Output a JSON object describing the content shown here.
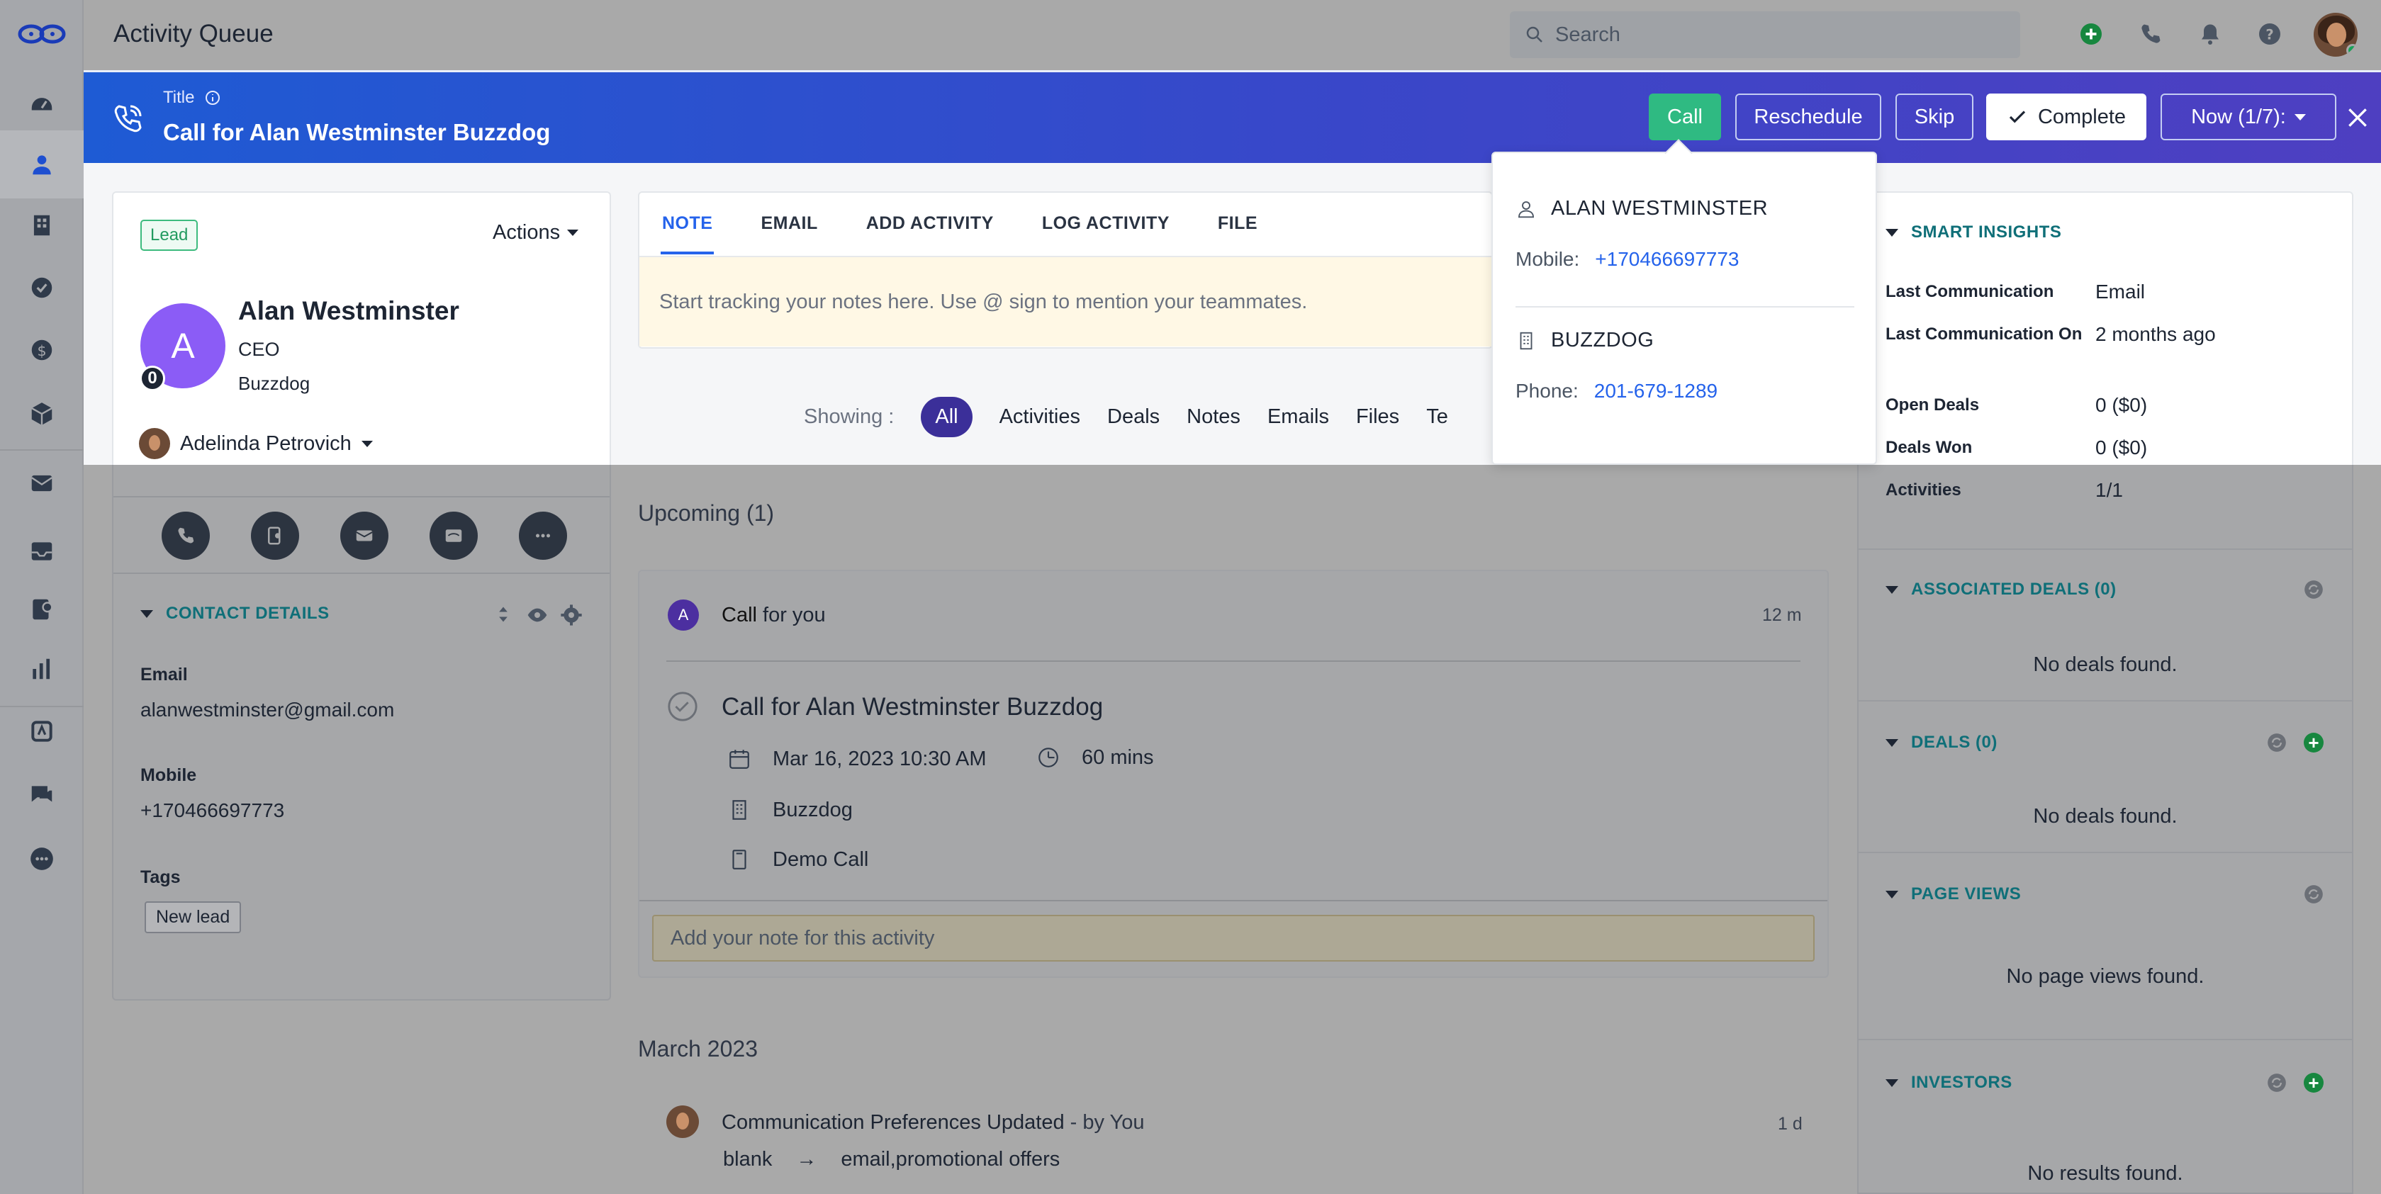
{
  "app": {
    "page_title": "Activity Queue"
  },
  "search": {
    "placeholder": "Search"
  },
  "banner": {
    "label": "Title",
    "title": "Call for Alan Westminster Buzzdog",
    "buttons": {
      "call": "Call",
      "reschedule": "Reschedule",
      "skip": "Skip",
      "complete": "Complete",
      "now": "Now (1/7):"
    }
  },
  "contact": {
    "badge": "Lead",
    "actions_label": "Actions",
    "initial": "A",
    "count_badge": "0",
    "name": "Alan Westminster",
    "title": "CEO",
    "company": "Buzzdog",
    "owner": "Adelinda Petrovich",
    "details_header": "CONTACT DETAILS",
    "fields": {
      "email_label": "Email",
      "email_value": "alanwestminster@gmail.com",
      "mobile_label": "Mobile",
      "mobile_value": "+170466697773",
      "tags_label": "Tags"
    },
    "tags": [
      "New lead"
    ]
  },
  "tabs": [
    "NOTE",
    "EMAIL",
    "ADD ACTIVITY",
    "LOG ACTIVITY",
    "FILE"
  ],
  "note": {
    "placeholder": "Start tracking your notes here. Use @ sign to mention your teammates."
  },
  "showing": {
    "label": "Showing :",
    "filters": [
      "All",
      "Activities",
      "Deals",
      "Notes",
      "Emails",
      "Files",
      "Te"
    ],
    "active": "All"
  },
  "popover": {
    "person_name": "ALAN WESTMINSTER",
    "mobile_label": "Mobile:",
    "mobile_value": "+170466697773",
    "company_name": "BUZZDOG",
    "phone_label": "Phone:",
    "phone_value": "201-679-1289"
  },
  "insights": {
    "header": "SMART INSIGHTS",
    "rows": [
      {
        "label": "Last Communication",
        "value": "Email"
      },
      {
        "label": "Last Communication On",
        "value": "2 months ago"
      },
      {
        "label": "Open Deals",
        "value": "0 ($0)"
      },
      {
        "label": "Deals Won",
        "value": "0 ($0)"
      },
      {
        "label": "Activities",
        "value": "1/1"
      }
    ]
  },
  "right_sections": [
    {
      "title": "ASSOCIATED DEALS (0)",
      "empty": "No deals found."
    },
    {
      "title": "DEALS (0)",
      "empty": "No deals found."
    },
    {
      "title": "PAGE VIEWS",
      "empty": "No page views found."
    },
    {
      "title": "INVESTORS",
      "empty": "No results found."
    }
  ],
  "upcoming": {
    "header": "Upcoming (1)",
    "avatar_initial": "A",
    "row_title_strong": "Call",
    "row_title_rest": " for you",
    "row_time": "12 m",
    "activity_title": "Call for Alan Westminster Buzzdog",
    "date": "Mar 16, 2023 10:30 AM",
    "duration": "60 mins",
    "company": "Buzzdog",
    "type": "Demo Call",
    "note_placeholder": "Add your note for this activity"
  },
  "history": {
    "month": "March 2023",
    "event_title": "Communication Preferences Updated",
    "event_by": " - by You",
    "event_time": "1 d",
    "from": "blank",
    "arrow": "→",
    "to": "email,promotional offers"
  },
  "colors": {
    "banner_start": "#1e5bd4",
    "banner_end": "#4e3fc1",
    "call_green": "#2fba82",
    "accent_blue": "#2563eb",
    "teal_header": "#0f6f78"
  }
}
